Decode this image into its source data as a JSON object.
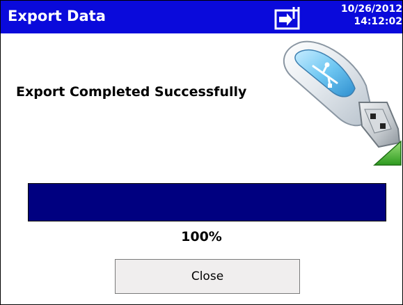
{
  "window": {
    "title": "Export Data",
    "date": "10/26/2012",
    "time": "14:12:02"
  },
  "status": {
    "message": "Export Completed Successfully",
    "progress_text": "100%",
    "progress_value": 1.0
  },
  "actions": {
    "close_label": "Close"
  },
  "icons": {
    "titlebar": "export-icon",
    "device": "usb-drive-icon"
  },
  "colors": {
    "titlebar": "#0a0adb",
    "progress_fill": "#000080",
    "button_face": "#f0eeee"
  }
}
